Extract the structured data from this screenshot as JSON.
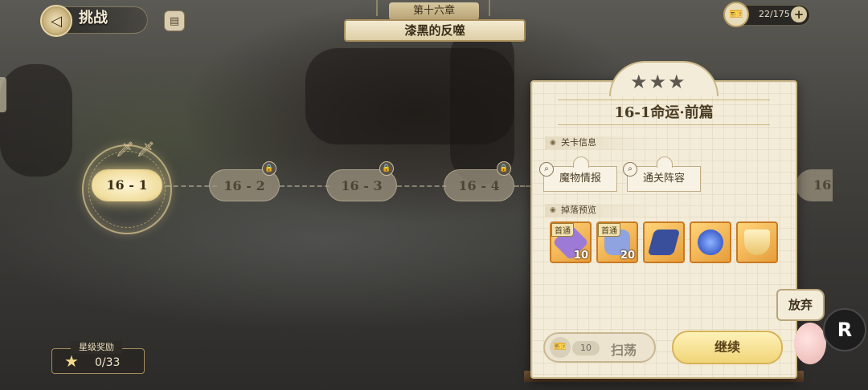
{
  "header": {
    "title": "挑战",
    "chapter_label": "第十六章",
    "chapter_name": "漆黑的反噬"
  },
  "stamina": {
    "text": "22/175",
    "plus": "+"
  },
  "stages": [
    {
      "label": "16 - 1",
      "state": "active"
    },
    {
      "label": "16 - 2",
      "state": "locked"
    },
    {
      "label": "16 - 3",
      "state": "locked"
    },
    {
      "label": "16 - 4",
      "state": "locked"
    },
    {
      "label": "16",
      "state": "locked"
    }
  ],
  "star_reward": {
    "title": "星级奖励",
    "count": "0/33"
  },
  "panel": {
    "stars": "★★★",
    "stage_title": "16-1命运·前篇",
    "section_info": "关卡信息",
    "monster_info": "魔物情报",
    "clear_lineup": "通关阵容",
    "section_drops": "掉落预览",
    "drops": [
      {
        "tag": "首通",
        "qty": "10",
        "color": "#9c7ad6"
      },
      {
        "tag": "首通",
        "qty": "20",
        "color": "#8fa3e0"
      },
      {
        "tag": "",
        "qty": "",
        "color": "#3a4f9c"
      },
      {
        "tag": "",
        "qty": "",
        "color": "#1f3fb8"
      },
      {
        "tag": "",
        "qty": "",
        "color": "#e9c36a"
      }
    ],
    "sweep_count": "10",
    "sweep_label": "扫荡",
    "continue_label": "继续"
  },
  "quit_label": "放弃",
  "r_label": "R"
}
